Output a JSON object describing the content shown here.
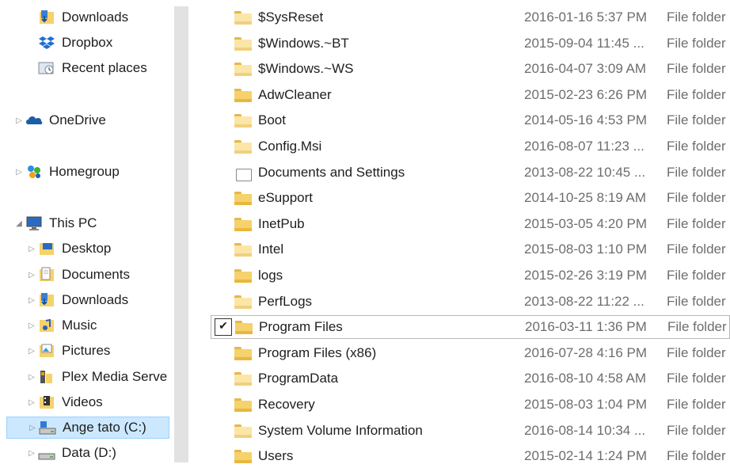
{
  "nav": {
    "items": [
      {
        "label": "Downloads",
        "icon": "downloads-folder-icon",
        "indent": 2,
        "expand": false
      },
      {
        "label": "Dropbox",
        "icon": "dropbox-icon",
        "indent": 2,
        "expand": false
      },
      {
        "label": "Recent places",
        "icon": "recent-places-icon",
        "indent": 2,
        "expand": false
      },
      {
        "label": "OneDrive",
        "icon": "onedrive-icon",
        "indent": 1,
        "expand": true
      },
      {
        "label": "Homegroup",
        "icon": "homegroup-icon",
        "indent": 1,
        "expand": true
      },
      {
        "label": "This PC",
        "icon": "this-pc-icon",
        "indent": 1,
        "expand": true,
        "expanded": true
      },
      {
        "label": "Desktop",
        "icon": "desktop-folder-icon",
        "indent": 2,
        "expand": true
      },
      {
        "label": "Documents",
        "icon": "documents-folder-icon",
        "indent": 2,
        "expand": true
      },
      {
        "label": "Downloads",
        "icon": "downloads-folder-icon",
        "indent": 2,
        "expand": true
      },
      {
        "label": "Music",
        "icon": "music-folder-icon",
        "indent": 2,
        "expand": true
      },
      {
        "label": "Pictures",
        "icon": "pictures-folder-icon",
        "indent": 2,
        "expand": true
      },
      {
        "label": "Plex Media Serve",
        "icon": "plex-icon",
        "indent": 2,
        "expand": true
      },
      {
        "label": "Videos",
        "icon": "videos-folder-icon",
        "indent": 2,
        "expand": true
      },
      {
        "label": "Ange tato (C:)",
        "icon": "drive-c-icon",
        "indent": 2,
        "expand": true,
        "selected": true
      },
      {
        "label": "Data (D:)",
        "icon": "drive-d-icon",
        "indent": 2,
        "expand": true
      }
    ]
  },
  "files": {
    "rows": [
      {
        "name": "$SysReset",
        "date": "2016-01-16 5:37 PM",
        "type": "File folder",
        "style": "light"
      },
      {
        "name": "$Windows.~BT",
        "date": "2015-09-04 11:45 ...",
        "type": "File folder",
        "style": "light"
      },
      {
        "name": "$Windows.~WS",
        "date": "2016-04-07 3:09 AM",
        "type": "File folder",
        "style": "light"
      },
      {
        "name": "AdwCleaner",
        "date": "2015-02-23 6:26 PM",
        "type": "File folder",
        "style": "normal"
      },
      {
        "name": "Boot",
        "date": "2014-05-16 4:53 PM",
        "type": "File folder",
        "style": "light"
      },
      {
        "name": "Config.Msi",
        "date": "2016-08-07 11:23 ...",
        "type": "File folder",
        "style": "light"
      },
      {
        "name": "Documents and Settings",
        "date": "2013-08-22 10:45 ...",
        "type": "File folder",
        "style": "link"
      },
      {
        "name": "eSupport",
        "date": "2014-10-25 8:19 AM",
        "type": "File folder",
        "style": "normal"
      },
      {
        "name": "InetPub",
        "date": "2015-03-05 4:20 PM",
        "type": "File folder",
        "style": "normal"
      },
      {
        "name": "Intel",
        "date": "2015-08-03 1:10 PM",
        "type": "File folder",
        "style": "light"
      },
      {
        "name": "logs",
        "date": "2015-02-26 3:19 PM",
        "type": "File folder",
        "style": "normal"
      },
      {
        "name": "PerfLogs",
        "date": "2013-08-22 11:22 ...",
        "type": "File folder",
        "style": "light"
      },
      {
        "name": "Program Files",
        "date": "2016-03-11 1:36 PM",
        "type": "File folder",
        "style": "normal",
        "checked": true
      },
      {
        "name": "Program Files (x86)",
        "date": "2016-07-28 4:16 PM",
        "type": "File folder",
        "style": "normal"
      },
      {
        "name": "ProgramData",
        "date": "2016-08-10 4:58 AM",
        "type": "File folder",
        "style": "light"
      },
      {
        "name": "Recovery",
        "date": "2015-08-03 1:04 PM",
        "type": "File folder",
        "style": "normal"
      },
      {
        "name": "System Volume Information",
        "date": "2016-08-14 10:34 ...",
        "type": "File folder",
        "style": "light"
      },
      {
        "name": "Users",
        "date": "2015-02-14 1:24 PM",
        "type": "File folder",
        "style": "normal"
      }
    ]
  },
  "colors": {
    "selection_bg": "#cce8ff",
    "selection_border": "#99d1ff",
    "folder": "#f5d26b",
    "meta_text": "#6d6d6d"
  }
}
